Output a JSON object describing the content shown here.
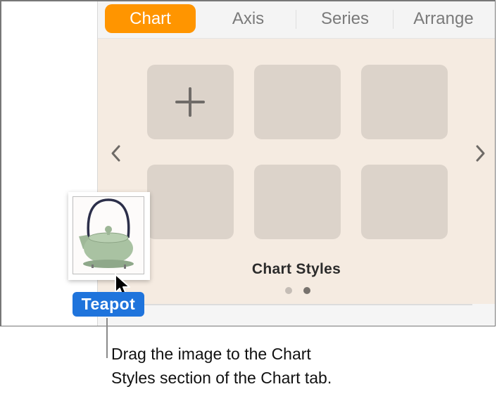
{
  "tabs": [
    {
      "label": "Chart",
      "active": true
    },
    {
      "label": "Axis",
      "active": false
    },
    {
      "label": "Series",
      "active": false
    },
    {
      "label": "Arrange",
      "active": false
    }
  ],
  "colors": {
    "accent": "#ff9500",
    "panel_background": "#f5ebe1",
    "tile": "#dcd3ca",
    "badge": "#1f74dc"
  },
  "chart_styles": {
    "label": "Chart Styles",
    "tiles": [
      {
        "icon": "plus-icon",
        "kind": "add-style"
      },
      {
        "kind": "empty"
      },
      {
        "kind": "empty"
      },
      {
        "kind": "empty"
      },
      {
        "kind": "empty"
      },
      {
        "kind": "empty"
      }
    ],
    "prev_icon": "chevron-left-icon",
    "next_icon": "chevron-right-icon",
    "page_count": 2,
    "current_page": 2
  },
  "drag_item": {
    "label": "Teapot",
    "image": "teapot-image"
  },
  "caption": {
    "line1": "Drag the image to the Chart",
    "line2": "Styles section of the Chart tab."
  }
}
